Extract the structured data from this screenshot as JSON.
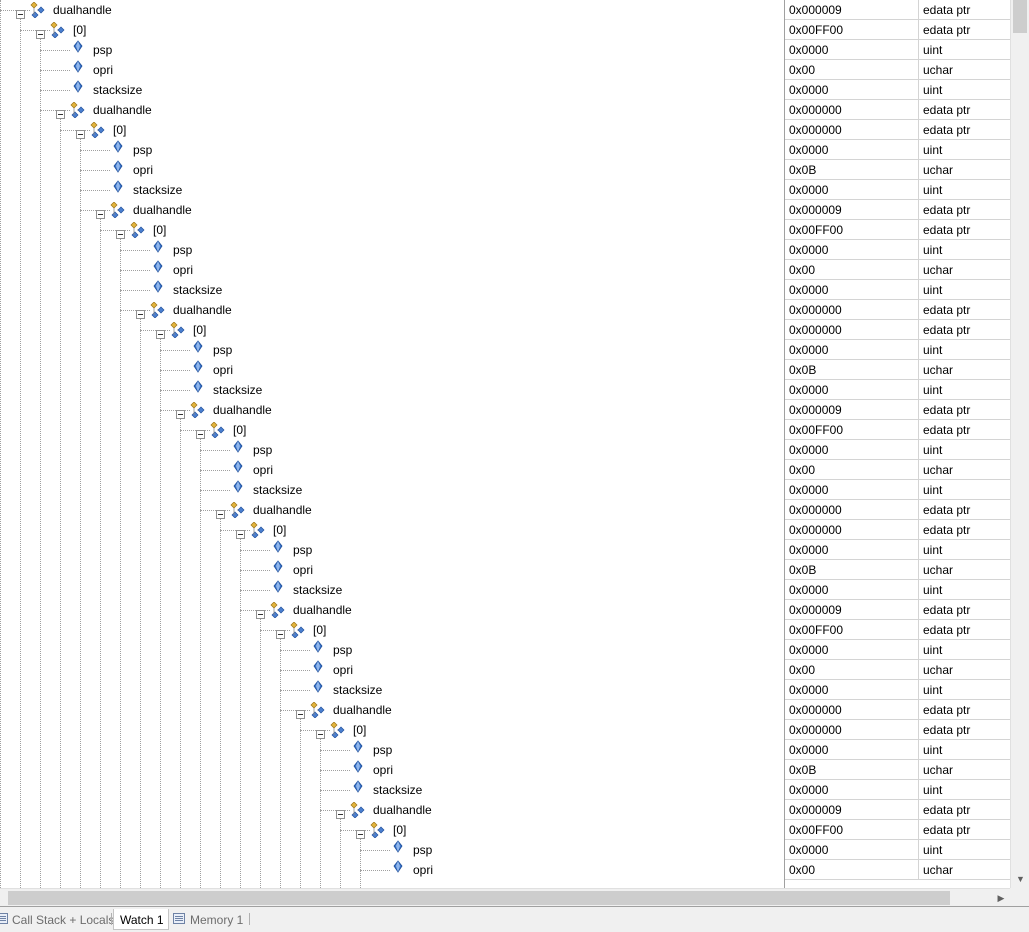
{
  "tabs": [
    {
      "label": "Call Stack + Locals",
      "active": false
    },
    {
      "label": "Watch 1",
      "active": true
    },
    {
      "label": "Memory 1",
      "active": false
    }
  ],
  "rows": [
    {
      "depth": 0,
      "kind": "struct",
      "name": "dualhandle",
      "value": "0x000009",
      "type": "edata ptr"
    },
    {
      "depth": 1,
      "kind": "struct",
      "name": "[0]",
      "value": "0x00FF00",
      "type": "edata ptr"
    },
    {
      "depth": 2,
      "kind": "field",
      "name": "psp",
      "value": "0x0000",
      "type": "uint"
    },
    {
      "depth": 2,
      "kind": "field",
      "name": "opri",
      "value": "0x00",
      "type": "uchar"
    },
    {
      "depth": 2,
      "kind": "field",
      "name": "stacksize",
      "value": "0x0000",
      "type": "uint"
    },
    {
      "depth": 2,
      "kind": "struct",
      "name": "dualhandle",
      "value": "0x000000",
      "type": "edata ptr"
    },
    {
      "depth": 3,
      "kind": "struct",
      "name": "[0]",
      "value": "0x000000",
      "type": "edata ptr"
    },
    {
      "depth": 4,
      "kind": "field",
      "name": "psp",
      "value": "0x0000",
      "type": "uint"
    },
    {
      "depth": 4,
      "kind": "field",
      "name": "opri",
      "value": "0x0B",
      "type": "uchar"
    },
    {
      "depth": 4,
      "kind": "field",
      "name": "stacksize",
      "value": "0x0000",
      "type": "uint"
    },
    {
      "depth": 4,
      "kind": "struct",
      "name": "dualhandle",
      "value": "0x000009",
      "type": "edata ptr"
    },
    {
      "depth": 5,
      "kind": "struct",
      "name": "[0]",
      "value": "0x00FF00",
      "type": "edata ptr"
    },
    {
      "depth": 6,
      "kind": "field",
      "name": "psp",
      "value": "0x0000",
      "type": "uint"
    },
    {
      "depth": 6,
      "kind": "field",
      "name": "opri",
      "value": "0x00",
      "type": "uchar"
    },
    {
      "depth": 6,
      "kind": "field",
      "name": "stacksize",
      "value": "0x0000",
      "type": "uint"
    },
    {
      "depth": 6,
      "kind": "struct",
      "name": "dualhandle",
      "value": "0x000000",
      "type": "edata ptr"
    },
    {
      "depth": 7,
      "kind": "struct",
      "name": "[0]",
      "value": "0x000000",
      "type": "edata ptr"
    },
    {
      "depth": 8,
      "kind": "field",
      "name": "psp",
      "value": "0x0000",
      "type": "uint"
    },
    {
      "depth": 8,
      "kind": "field",
      "name": "opri",
      "value": "0x0B",
      "type": "uchar"
    },
    {
      "depth": 8,
      "kind": "field",
      "name": "stacksize",
      "value": "0x0000",
      "type": "uint"
    },
    {
      "depth": 8,
      "kind": "struct",
      "name": "dualhandle",
      "value": "0x000009",
      "type": "edata ptr"
    },
    {
      "depth": 9,
      "kind": "struct",
      "name": "[0]",
      "value": "0x00FF00",
      "type": "edata ptr"
    },
    {
      "depth": 10,
      "kind": "field",
      "name": "psp",
      "value": "0x0000",
      "type": "uint"
    },
    {
      "depth": 10,
      "kind": "field",
      "name": "opri",
      "value": "0x00",
      "type": "uchar"
    },
    {
      "depth": 10,
      "kind": "field",
      "name": "stacksize",
      "value": "0x0000",
      "type": "uint"
    },
    {
      "depth": 10,
      "kind": "struct",
      "name": "dualhandle",
      "value": "0x000000",
      "type": "edata ptr"
    },
    {
      "depth": 11,
      "kind": "struct",
      "name": "[0]",
      "value": "0x000000",
      "type": "edata ptr"
    },
    {
      "depth": 12,
      "kind": "field",
      "name": "psp",
      "value": "0x0000",
      "type": "uint"
    },
    {
      "depth": 12,
      "kind": "field",
      "name": "opri",
      "value": "0x0B",
      "type": "uchar"
    },
    {
      "depth": 12,
      "kind": "field",
      "name": "stacksize",
      "value": "0x0000",
      "type": "uint"
    },
    {
      "depth": 12,
      "kind": "struct",
      "name": "dualhandle",
      "value": "0x000009",
      "type": "edata ptr"
    },
    {
      "depth": 13,
      "kind": "struct",
      "name": "[0]",
      "value": "0x00FF00",
      "type": "edata ptr"
    },
    {
      "depth": 14,
      "kind": "field",
      "name": "psp",
      "value": "0x0000",
      "type": "uint"
    },
    {
      "depth": 14,
      "kind": "field",
      "name": "opri",
      "value": "0x00",
      "type": "uchar"
    },
    {
      "depth": 14,
      "kind": "field",
      "name": "stacksize",
      "value": "0x0000",
      "type": "uint"
    },
    {
      "depth": 14,
      "kind": "struct",
      "name": "dualhandle",
      "value": "0x000000",
      "type": "edata ptr"
    },
    {
      "depth": 15,
      "kind": "struct",
      "name": "[0]",
      "value": "0x000000",
      "type": "edata ptr"
    },
    {
      "depth": 16,
      "kind": "field",
      "name": "psp",
      "value": "0x0000",
      "type": "uint"
    },
    {
      "depth": 16,
      "kind": "field",
      "name": "opri",
      "value": "0x0B",
      "type": "uchar"
    },
    {
      "depth": 16,
      "kind": "field",
      "name": "stacksize",
      "value": "0x0000",
      "type": "uint"
    },
    {
      "depth": 16,
      "kind": "struct",
      "name": "dualhandle",
      "value": "0x000009",
      "type": "edata ptr"
    },
    {
      "depth": 17,
      "kind": "struct",
      "name": "[0]",
      "value": "0x00FF00",
      "type": "edata ptr"
    },
    {
      "depth": 18,
      "kind": "field",
      "name": "psp",
      "value": "0x0000",
      "type": "uint"
    },
    {
      "depth": 18,
      "kind": "field",
      "name": "opri",
      "value": "0x00",
      "type": "uchar"
    }
  ],
  "icons": {
    "struct": "struct-icon",
    "field": "field-icon"
  },
  "colors": {
    "field_blue": "#3b74c9",
    "struct_gold": "#e2b33c",
    "struct_blue": "#4a7fd0"
  }
}
